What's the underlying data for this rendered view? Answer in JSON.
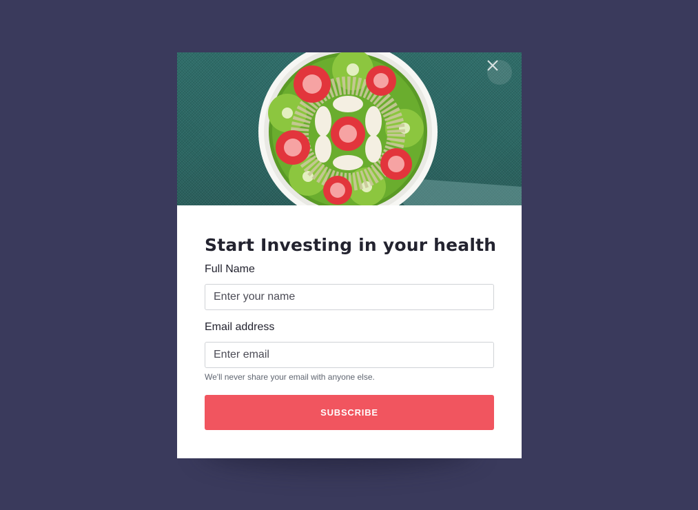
{
  "modal": {
    "close_icon": "close-icon",
    "hero_image": "smoothie-bowl-image",
    "title": "Start Investing in your health",
    "full_name": {
      "label": "Full Name",
      "placeholder": "Enter your name",
      "value": ""
    },
    "email": {
      "label": "Email address",
      "placeholder": "Enter email",
      "value": "",
      "help": "We'll never share your email with anyone else."
    },
    "subscribe_label": "SUBSCRIBE"
  },
  "colors": {
    "background": "#3a3a5c",
    "accent": "#f1555f",
    "title": "#23232f"
  }
}
